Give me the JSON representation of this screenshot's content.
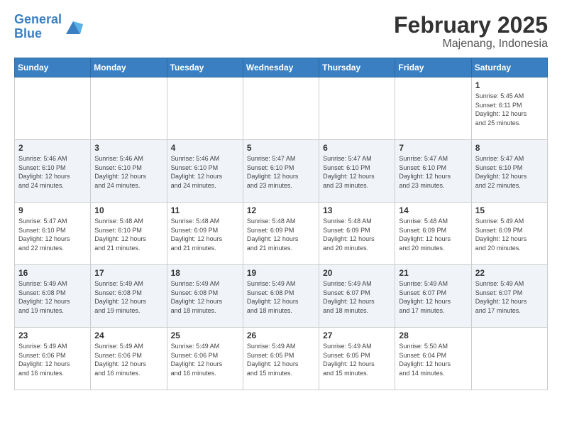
{
  "header": {
    "logo_text_general": "General",
    "logo_text_blue": "Blue",
    "title": "February 2025",
    "subtitle": "Majenang, Indonesia"
  },
  "days_of_week": [
    "Sunday",
    "Monday",
    "Tuesday",
    "Wednesday",
    "Thursday",
    "Friday",
    "Saturday"
  ],
  "weeks": [
    [
      {
        "num": "",
        "info": ""
      },
      {
        "num": "",
        "info": ""
      },
      {
        "num": "",
        "info": ""
      },
      {
        "num": "",
        "info": ""
      },
      {
        "num": "",
        "info": ""
      },
      {
        "num": "",
        "info": ""
      },
      {
        "num": "1",
        "info": "Sunrise: 5:45 AM\nSunset: 6:11 PM\nDaylight: 12 hours\nand 25 minutes."
      }
    ],
    [
      {
        "num": "2",
        "info": "Sunrise: 5:46 AM\nSunset: 6:10 PM\nDaylight: 12 hours\nand 24 minutes."
      },
      {
        "num": "3",
        "info": "Sunrise: 5:46 AM\nSunset: 6:10 PM\nDaylight: 12 hours\nand 24 minutes."
      },
      {
        "num": "4",
        "info": "Sunrise: 5:46 AM\nSunset: 6:10 PM\nDaylight: 12 hours\nand 24 minutes."
      },
      {
        "num": "5",
        "info": "Sunrise: 5:47 AM\nSunset: 6:10 PM\nDaylight: 12 hours\nand 23 minutes."
      },
      {
        "num": "6",
        "info": "Sunrise: 5:47 AM\nSunset: 6:10 PM\nDaylight: 12 hours\nand 23 minutes."
      },
      {
        "num": "7",
        "info": "Sunrise: 5:47 AM\nSunset: 6:10 PM\nDaylight: 12 hours\nand 23 minutes."
      },
      {
        "num": "8",
        "info": "Sunrise: 5:47 AM\nSunset: 6:10 PM\nDaylight: 12 hours\nand 22 minutes."
      }
    ],
    [
      {
        "num": "9",
        "info": "Sunrise: 5:47 AM\nSunset: 6:10 PM\nDaylight: 12 hours\nand 22 minutes."
      },
      {
        "num": "10",
        "info": "Sunrise: 5:48 AM\nSunset: 6:10 PM\nDaylight: 12 hours\nand 21 minutes."
      },
      {
        "num": "11",
        "info": "Sunrise: 5:48 AM\nSunset: 6:09 PM\nDaylight: 12 hours\nand 21 minutes."
      },
      {
        "num": "12",
        "info": "Sunrise: 5:48 AM\nSunset: 6:09 PM\nDaylight: 12 hours\nand 21 minutes."
      },
      {
        "num": "13",
        "info": "Sunrise: 5:48 AM\nSunset: 6:09 PM\nDaylight: 12 hours\nand 20 minutes."
      },
      {
        "num": "14",
        "info": "Sunrise: 5:48 AM\nSunset: 6:09 PM\nDaylight: 12 hours\nand 20 minutes."
      },
      {
        "num": "15",
        "info": "Sunrise: 5:49 AM\nSunset: 6:09 PM\nDaylight: 12 hours\nand 20 minutes."
      }
    ],
    [
      {
        "num": "16",
        "info": "Sunrise: 5:49 AM\nSunset: 6:08 PM\nDaylight: 12 hours\nand 19 minutes."
      },
      {
        "num": "17",
        "info": "Sunrise: 5:49 AM\nSunset: 6:08 PM\nDaylight: 12 hours\nand 19 minutes."
      },
      {
        "num": "18",
        "info": "Sunrise: 5:49 AM\nSunset: 6:08 PM\nDaylight: 12 hours\nand 18 minutes."
      },
      {
        "num": "19",
        "info": "Sunrise: 5:49 AM\nSunset: 6:08 PM\nDaylight: 12 hours\nand 18 minutes."
      },
      {
        "num": "20",
        "info": "Sunrise: 5:49 AM\nSunset: 6:07 PM\nDaylight: 12 hours\nand 18 minutes."
      },
      {
        "num": "21",
        "info": "Sunrise: 5:49 AM\nSunset: 6:07 PM\nDaylight: 12 hours\nand 17 minutes."
      },
      {
        "num": "22",
        "info": "Sunrise: 5:49 AM\nSunset: 6:07 PM\nDaylight: 12 hours\nand 17 minutes."
      }
    ],
    [
      {
        "num": "23",
        "info": "Sunrise: 5:49 AM\nSunset: 6:06 PM\nDaylight: 12 hours\nand 16 minutes."
      },
      {
        "num": "24",
        "info": "Sunrise: 5:49 AM\nSunset: 6:06 PM\nDaylight: 12 hours\nand 16 minutes."
      },
      {
        "num": "25",
        "info": "Sunrise: 5:49 AM\nSunset: 6:06 PM\nDaylight: 12 hours\nand 16 minutes."
      },
      {
        "num": "26",
        "info": "Sunrise: 5:49 AM\nSunset: 6:05 PM\nDaylight: 12 hours\nand 15 minutes."
      },
      {
        "num": "27",
        "info": "Sunrise: 5:49 AM\nSunset: 6:05 PM\nDaylight: 12 hours\nand 15 minutes."
      },
      {
        "num": "28",
        "info": "Sunrise: 5:50 AM\nSunset: 6:04 PM\nDaylight: 12 hours\nand 14 minutes."
      },
      {
        "num": "",
        "info": ""
      }
    ]
  ]
}
